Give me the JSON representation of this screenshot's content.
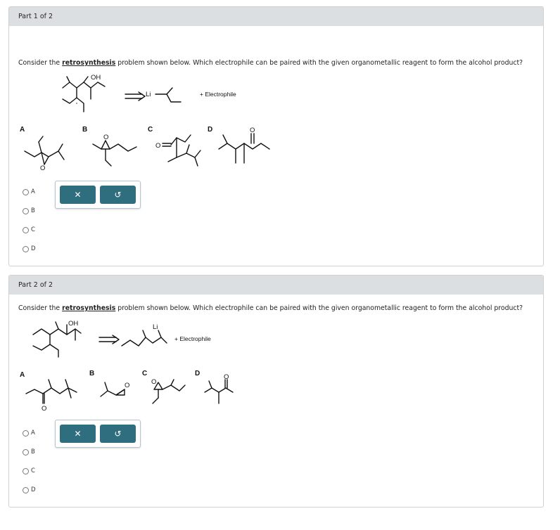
{
  "parts": [
    {
      "header": "Part 1 of 2",
      "prompt_pre": "Consider the ",
      "prompt_link": "retrosynthesis",
      "prompt_post": " problem shown below. Which electrophile can be paired with the given organometallic reagent to form the alcohol product?",
      "oh_label": "OH",
      "reagent_metal": "Li",
      "electrophile_text": "+ Electrophile",
      "choice_letters": [
        "A",
        "B",
        "C",
        "D"
      ],
      "oxygen_label": "O",
      "options": [
        "A",
        "B",
        "C",
        "D"
      ],
      "clear_icon": "✕",
      "undo_icon": "↺"
    },
    {
      "header": "Part 2 of 2",
      "prompt_pre": "Consider the ",
      "prompt_link": "retrosynthesis",
      "prompt_post": " problem shown below. Which electrophile can be paired with the given organometallic reagent to form the alcohol product?",
      "oh_label": "OH",
      "reagent_metal": "Li",
      "electrophile_text": "+ Electrophile",
      "choice_letters": [
        "A",
        "B",
        "C",
        "D"
      ],
      "oxygen_label": "O",
      "options": [
        "A",
        "B",
        "C",
        "D"
      ],
      "clear_icon": "✕",
      "undo_icon": "↺"
    }
  ]
}
